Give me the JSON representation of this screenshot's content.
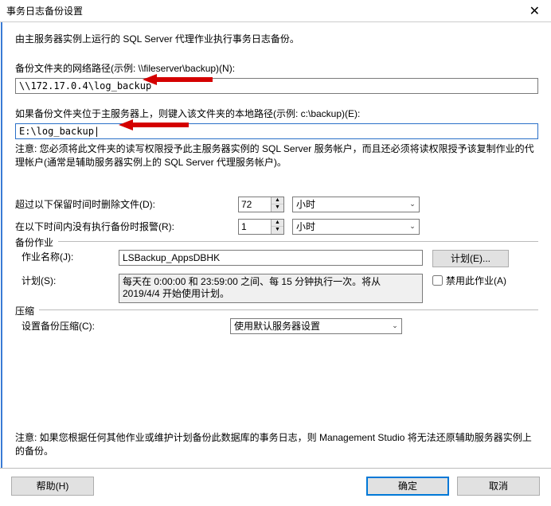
{
  "title": "事务日志备份设置",
  "intro": "由主服务器实例上运行的 SQL Server 代理作业执行事务日志备份。",
  "network_path": {
    "label": "备份文件夹的网络路径(示例: \\\\fileserver\\backup)(N):",
    "value": "\\\\172.17.0.4\\log_backup"
  },
  "local_path": {
    "label": "如果备份文件夹位于主服务器上，则键入该文件夹的本地路径(示例: c:\\backup)(E):",
    "value": "E:\\log_backup|",
    "hint": "注意: 您必须将此文件夹的读写权限授予此主服务器实例的 SQL Server 服务帐户，而且还必须将读权限授予该复制作业的代理帐户(通常是辅助服务器实例上的 SQL Server 代理服务帐户)。"
  },
  "delete_after": {
    "label": "超过以下保留时间时删除文件(D):",
    "value": "72",
    "unit": "小时"
  },
  "alert_after": {
    "label": "在以下时间内没有执行备份时报警(R):",
    "value": "1",
    "unit": "小时"
  },
  "backup_job": {
    "legend": "备份作业",
    "job_name_label": "作业名称(J):",
    "job_name_value": "LSBackup_AppsDBHK",
    "schedule_btn": "计划(E)...",
    "schedule_label": "计划(S):",
    "schedule_text": "每天在 0:00:00 和 23:59:00 之间、每 15 分钟执行一次。将从 2019/4/4 开始使用计划。",
    "disable_checkbox": "禁用此作业(A)"
  },
  "compression": {
    "legend": "压缩",
    "label": "设置备份压缩(C):",
    "value": "使用默认服务器设置"
  },
  "bottom_note": "注意: 如果您根据任何其他作业或维护计划备份此数据库的事务日志，则 Management Studio 将无法还原辅助服务器实例上的备份。",
  "buttons": {
    "help": "帮助(H)",
    "ok": "确定",
    "cancel": "取消"
  }
}
